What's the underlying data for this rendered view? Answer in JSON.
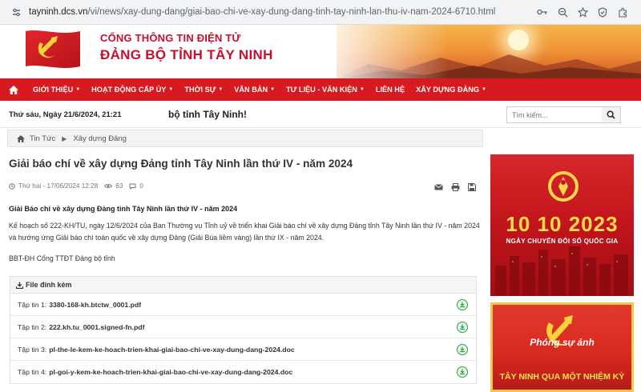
{
  "browser": {
    "url_host": "tayninh.dcs.vn",
    "url_path": "/vi/news/xay-dung-dang/giai-bao-chi-ve-xay-dung-dang-tinh-tay-ninh-lan-thu-iv-nam-2024-6710.html"
  },
  "header": {
    "title_line1": "CỔNG THÔNG TIN ĐIỆN TỬ",
    "title_line2": "ĐẢNG BỘ TỈNH TÂY NINH"
  },
  "nav": {
    "items": [
      {
        "label": "GIỚI THIỆU",
        "has_caret": true
      },
      {
        "label": "HOẠT ĐỘNG CẤP ỦY",
        "has_caret": true
      },
      {
        "label": "THỜI SỰ",
        "has_caret": true
      },
      {
        "label": "VĂN BẢN",
        "has_caret": true
      },
      {
        "label": "TƯ LIỆU - VĂN KIỆN",
        "has_caret": true
      },
      {
        "label": "LIÊN HỆ",
        "has_caret": false
      },
      {
        "label": "XÂY DỰNG ĐẢNG",
        "has_caret": true
      }
    ],
    "background": "#d71920"
  },
  "infobar": {
    "date": "Thứ sáu, Ngày 21/6/2024, 21:21",
    "ticker": "bộ tỉnh Tây Ninh!",
    "search_placeholder": "Tìm kiếm..."
  },
  "breadcrumb": {
    "items": [
      "Tin Tức",
      "Xây dựng Đảng"
    ]
  },
  "article": {
    "title": "Giải báo chí về xây dựng Đảng tỉnh Tây Ninh lần thứ IV - năm 2024",
    "date": "Thứ hai - 17/06/2024 12:28",
    "views": "63",
    "comments": "0",
    "lead": "Giải Báo chí về xây dựng Đảng tỉnh Tây Ninh lần thứ IV - năm 2024",
    "body": "Kế hoạch số 222-KH/TU, ngày 12/6/2024 của Ban Thường vụ Tỉnh uỷ về triển khai Giải báo chí về xây dựng Đảng tỉnh Tây Ninh lần thứ IV - năm 2024 và hướng ứng Giải báo chí toàn quốc về xây dựng Đảng (Giải Búa liềm vàng) lần thứ IX - năm 2024.",
    "signature": "BBT-ĐH Cổng TTĐT Đảng bộ tỉnh"
  },
  "files": {
    "heading": "File đính kèm",
    "items": [
      {
        "label": "Tập tin 1:",
        "name": "3380-168-kh.btctw_0001.pdf"
      },
      {
        "label": "Tập tin 2:",
        "name": "222.kh.tu_0001.signed-fn.pdf"
      },
      {
        "label": "Tập tin 3:",
        "name": "pl-the-le-kem-ke-hoach-trien-khai-giai-bao-chi-ve-xay-dung-dang-2024.doc"
      },
      {
        "label": "Tập tin 4:",
        "name": "pl-goi-y-kem-ke-hoach-trien-khai-giai-bao-chi-ve-xay-dung-dang-2024.doc"
      }
    ]
  },
  "sidebar": {
    "banner1": {
      "number": "10 10 2023",
      "caption": "NGÀY CHUYỂN ĐỔI SỐ QUỐC GIA"
    },
    "banner2": {
      "line1": "Phóng sự ảnh",
      "line2": "TÂY NINH QUA MỘT NHIỆM KỲ"
    }
  }
}
